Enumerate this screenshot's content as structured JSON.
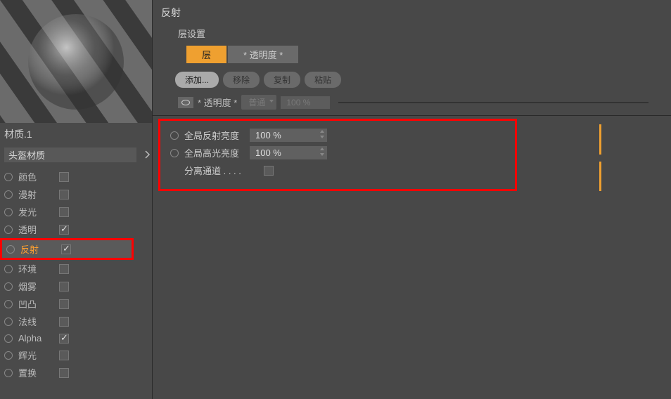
{
  "sidebar": {
    "material_name_label": "材质.1",
    "material_input_value": "头盔材质",
    "channels": [
      {
        "label": "颜色",
        "checked": false,
        "selected": false
      },
      {
        "label": "漫射",
        "checked": false,
        "selected": false
      },
      {
        "label": "发光",
        "checked": false,
        "selected": false
      },
      {
        "label": "透明",
        "checked": true,
        "selected": false
      },
      {
        "label": "反射",
        "checked": true,
        "selected": true
      },
      {
        "label": "环境",
        "checked": false,
        "selected": false
      },
      {
        "label": "烟雾",
        "checked": false,
        "selected": false
      },
      {
        "label": "凹凸",
        "checked": false,
        "selected": false
      },
      {
        "label": "法线",
        "checked": false,
        "selected": false
      },
      {
        "label": "Alpha",
        "checked": true,
        "selected": false
      },
      {
        "label": "辉光",
        "checked": false,
        "selected": false
      },
      {
        "label": "置换",
        "checked": false,
        "selected": false
      }
    ]
  },
  "main": {
    "title": "反射",
    "group_label": "层设置",
    "tabs": [
      {
        "label": "层",
        "active": true
      },
      {
        "label": "* 透明度 *",
        "active": false
      }
    ],
    "buttons": {
      "add": "添加...",
      "remove": "移除",
      "copy": "复制",
      "paste": "粘贴"
    },
    "opacity_row": {
      "label": "* 透明度 *",
      "mode": "普通",
      "value": "100 %"
    },
    "globals": {
      "reflect_brightness_label": "全局反射亮度",
      "reflect_brightness_value": "100 %",
      "specular_brightness_label": "全局高光亮度",
      "specular_brightness_value": "100 %",
      "separate_pass_label": "分离通道 . . . .",
      "separate_pass_checked": false
    }
  }
}
